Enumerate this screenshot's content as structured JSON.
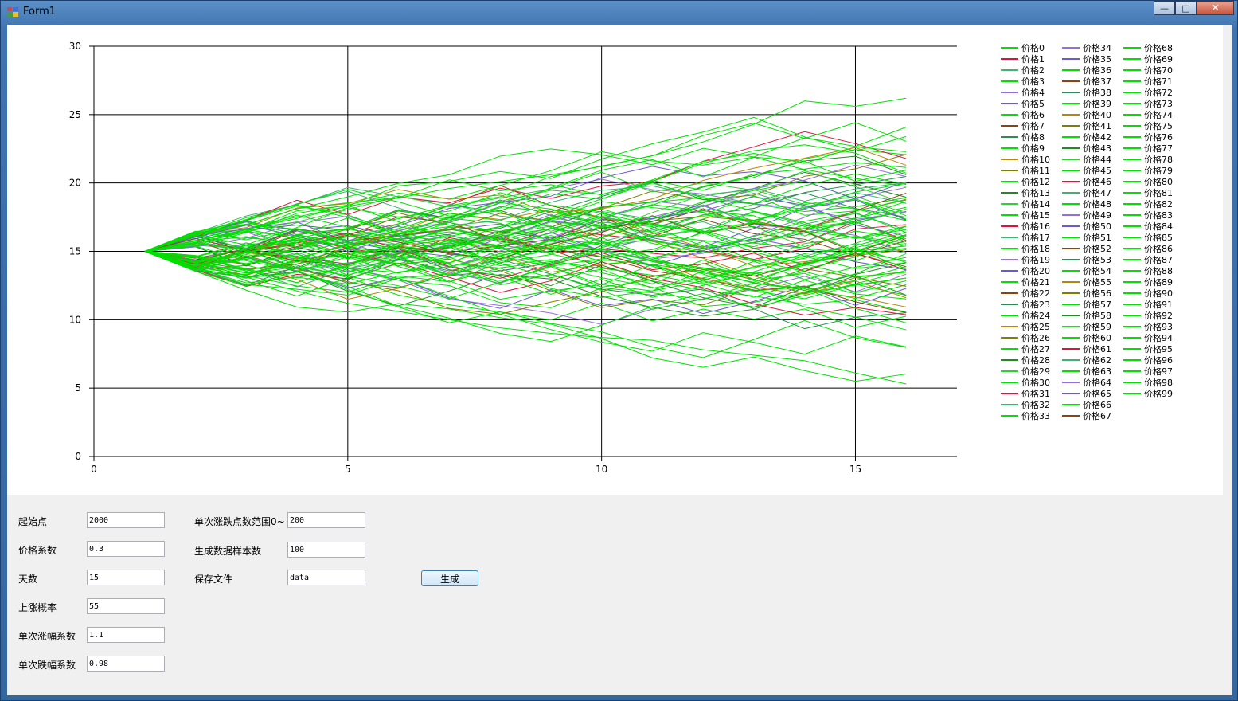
{
  "window": {
    "title": "Form1",
    "minimize_glyph": "—",
    "maximize_glyph": "□",
    "close_glyph": "✕"
  },
  "form": {
    "fields_left": [
      {
        "label": "起始点",
        "value": "2000"
      },
      {
        "label": "价格系数",
        "value": "0.3"
      },
      {
        "label": "天数",
        "value": "15"
      },
      {
        "label": "上涨概率",
        "value": "55"
      },
      {
        "label": "单次涨幅系数",
        "value": "1.1"
      },
      {
        "label": "单次跌幅系数",
        "value": "0.98"
      }
    ],
    "fields_right": [
      {
        "label": "单次涨跌点数范围0~",
        "value": "200"
      },
      {
        "label": "生成数据样本数",
        "value": "100"
      },
      {
        "label": "保存文件",
        "value": "data"
      }
    ],
    "generate_button": "生成"
  },
  "chart_data": {
    "type": "line",
    "title": "",
    "xlabel": "",
    "ylabel": "",
    "xlim": [
      0,
      17
    ],
    "ylim": [
      0,
      30
    ],
    "x_ticks": [
      0,
      5,
      10,
      15
    ],
    "y_ticks": [
      0,
      5,
      10,
      15,
      20,
      25,
      30
    ],
    "grid": true,
    "legend_position": "right",
    "series_count": 100,
    "series_name_prefix": "价格",
    "x": [
      1,
      2,
      3,
      4,
      5,
      6,
      7,
      8,
      9,
      10,
      11,
      12,
      13,
      14,
      15,
      16
    ],
    "start_value": 15,
    "approximate_final_range": [
      5.3,
      26.2
    ],
    "highlight_series": [
      {
        "name": "价格0",
        "values": [
          15,
          15.8,
          16.6,
          17.4,
          18.3,
          18.9,
          19.6,
          20.1,
          20.6,
          21.2,
          22.0,
          23.0,
          24.3,
          26.0,
          25.6,
          26.2
        ]
      },
      {
        "name": "价格1",
        "values": [
          15,
          14.0,
          13.1,
          12.1,
          11.2,
          10.6,
          10.0,
          9.4,
          9.0,
          8.7,
          8.5,
          7.8,
          7.4,
          7.0,
          6.1,
          5.3
        ]
      }
    ]
  },
  "colors": {
    "accent_green": "#00e000",
    "palette": [
      "#20b2aa",
      "#dc143c",
      "#3cb371",
      "#708090",
      "#9370db",
      "#6a5acd",
      "#5f9ea0",
      "#8b4513",
      "#2e8b57",
      "#4682b4",
      "#b8860b",
      "#808000",
      "#00ced1",
      "#228b22",
      "#32cd32"
    ]
  }
}
